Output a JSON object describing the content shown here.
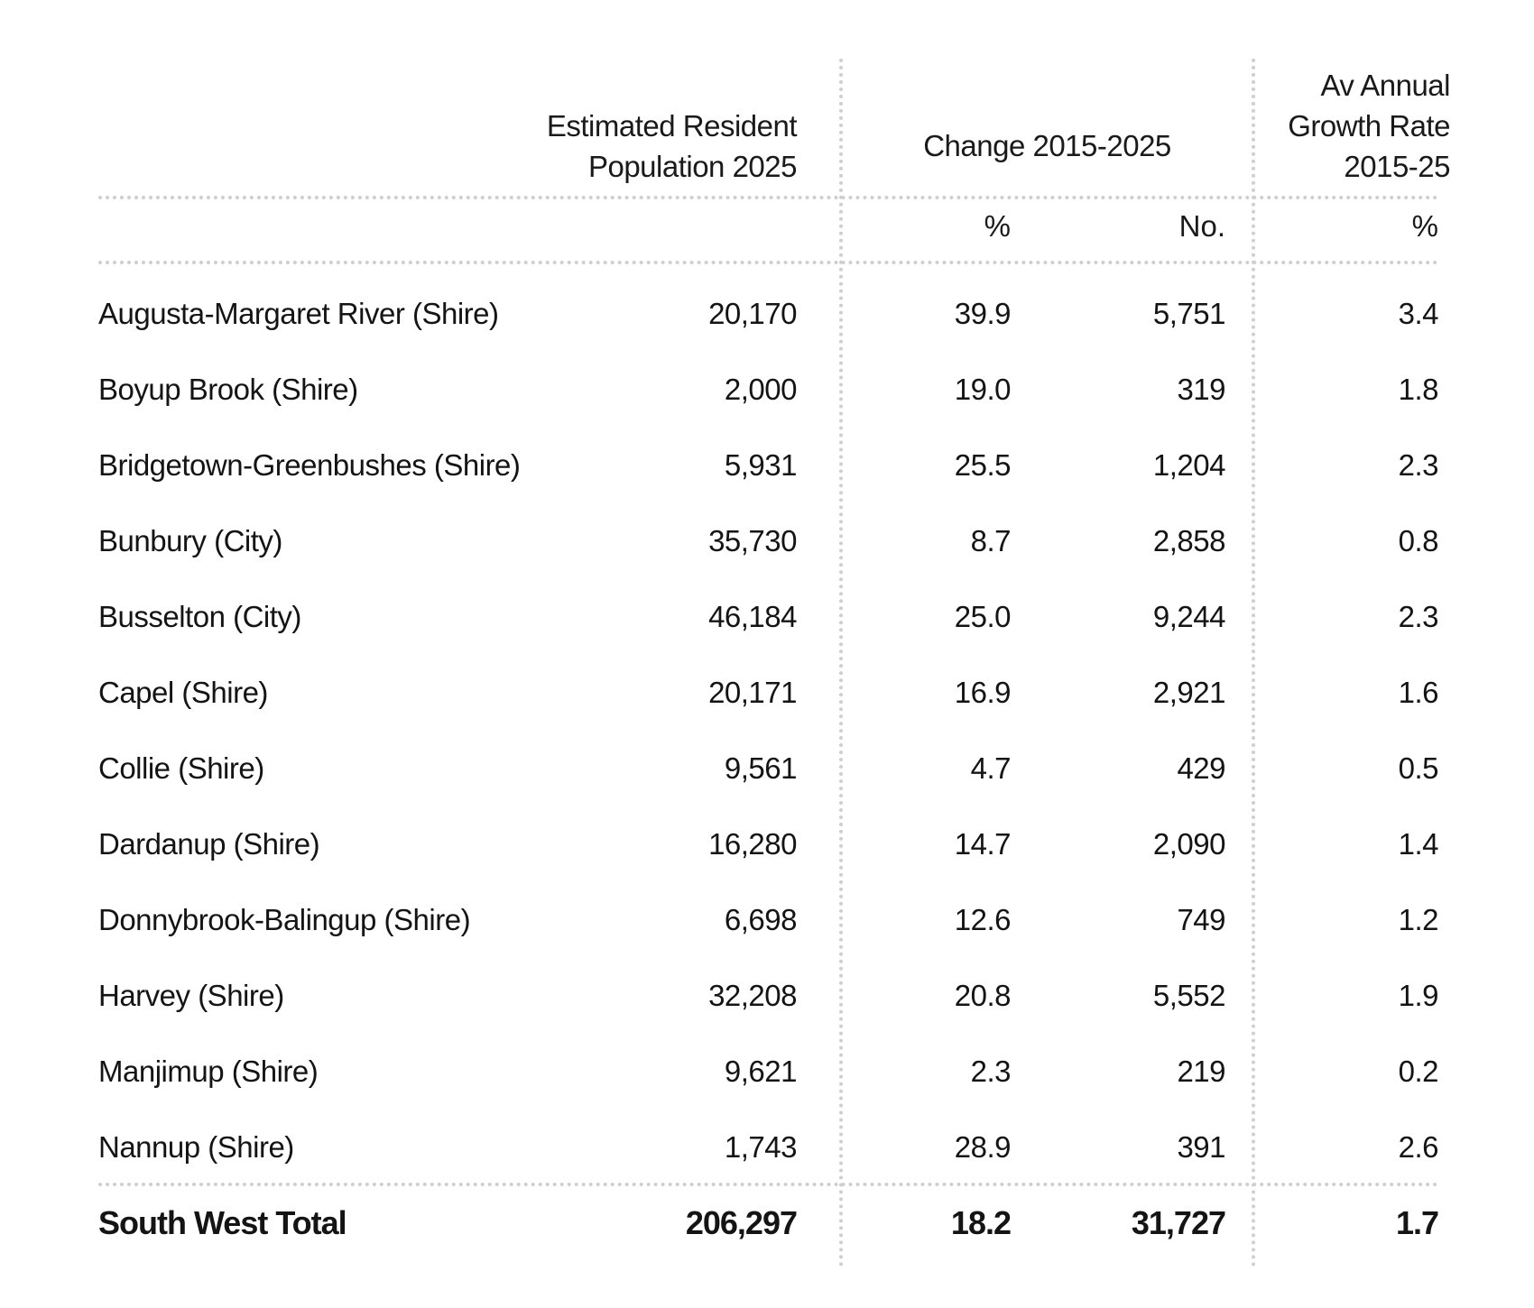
{
  "headers": {
    "erp_line1": "Estimated Resident",
    "erp_line2": "Population 2025",
    "change": "Change 2015-2025",
    "growth_line1": "Av Annual",
    "growth_line2": "Growth Rate",
    "growth_line3": "2015-25"
  },
  "units": {
    "change_pct": "%",
    "change_no": "No.",
    "growth_pct": "%"
  },
  "rows": [
    {
      "name": "Augusta-Margaret River (Shire)",
      "erp": "20,170",
      "pct": "39.9",
      "no": "5,751",
      "avg": "3.4"
    },
    {
      "name": "Boyup Brook (Shire)",
      "erp": "2,000",
      "pct": "19.0",
      "no": "319",
      "avg": "1.8"
    },
    {
      "name": "Bridgetown-Greenbushes (Shire)",
      "erp": "5,931",
      "pct": "25.5",
      "no": "1,204",
      "avg": "2.3"
    },
    {
      "name": "Bunbury (City)",
      "erp": "35,730",
      "pct": "8.7",
      "no": "2,858",
      "avg": "0.8"
    },
    {
      "name": "Busselton (City)",
      "erp": "46,184",
      "pct": "25.0",
      "no": "9,244",
      "avg": "2.3"
    },
    {
      "name": "Capel (Shire)",
      "erp": "20,171",
      "pct": "16.9",
      "no": "2,921",
      "avg": "1.6"
    },
    {
      "name": "Collie (Shire)",
      "erp": "9,561",
      "pct": "4.7",
      "no": "429",
      "avg": "0.5"
    },
    {
      "name": "Dardanup (Shire)",
      "erp": "16,280",
      "pct": "14.7",
      "no": "2,090",
      "avg": "1.4"
    },
    {
      "name": "Donnybrook-Balingup (Shire)",
      "erp": "6,698",
      "pct": "12.6",
      "no": "749",
      "avg": "1.2"
    },
    {
      "name": "Harvey (Shire)",
      "erp": "32,208",
      "pct": "20.8",
      "no": "5,552",
      "avg": "1.9"
    },
    {
      "name": "Manjimup (Shire)",
      "erp": "9,621",
      "pct": "2.3",
      "no": "219",
      "avg": "0.2"
    },
    {
      "name": "Nannup (Shire)",
      "erp": "1,743",
      "pct": "28.9",
      "no": "391",
      "avg": "2.6"
    }
  ],
  "total": {
    "name": "South West Total",
    "erp": "206,297",
    "pct": "18.2",
    "no": "31,727",
    "avg": "1.7"
  }
}
